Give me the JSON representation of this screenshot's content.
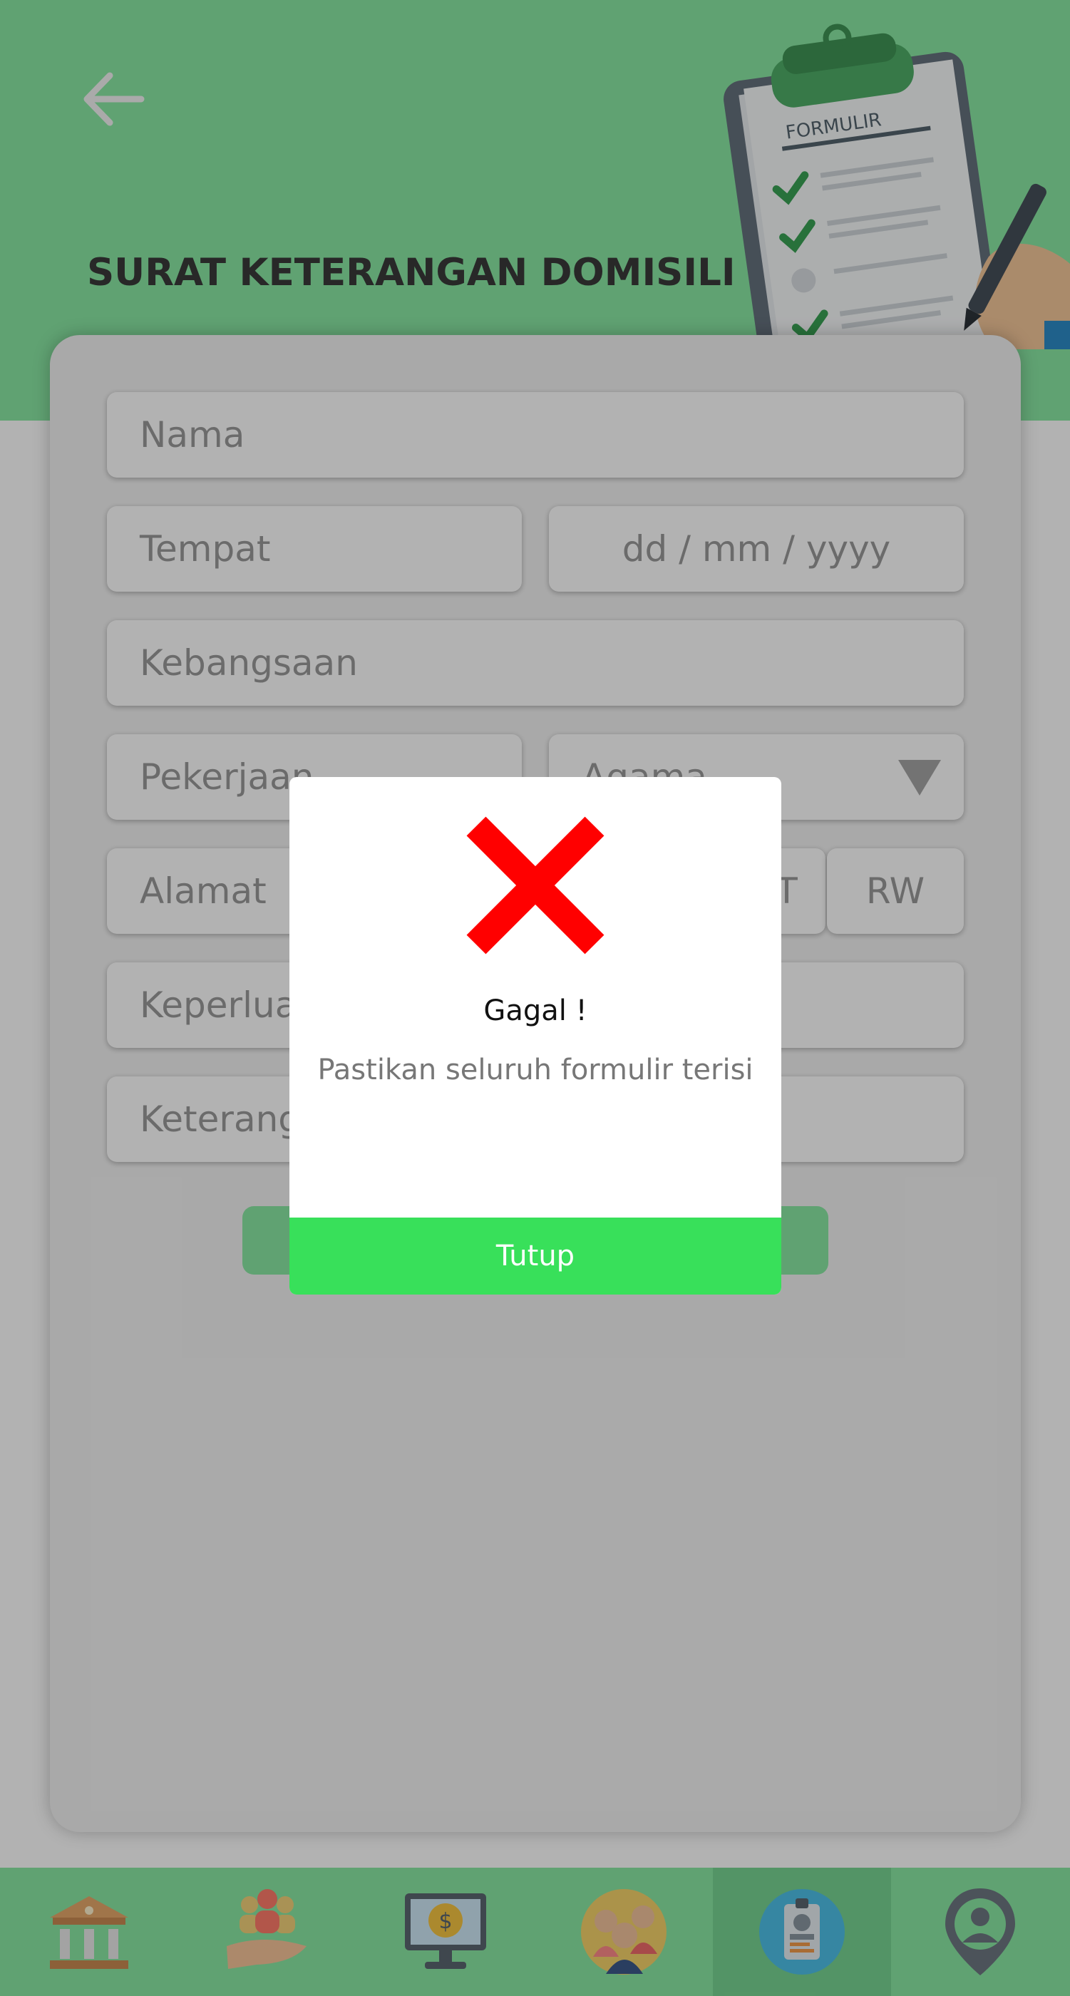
{
  "header": {
    "title": "SURAT KETERANGAN DOMISILI",
    "clipboard_label": "FORMULIR"
  },
  "form": {
    "nama": "Nama",
    "tempat": "Tempat",
    "tanggal": "dd / mm / yyyy",
    "kebangsaan": "Kebangsaan",
    "pekerjaan": "Pekerjaan",
    "agama": "Agama",
    "alamat": "Alamat",
    "rt": "RT",
    "rw": "RW",
    "keperluan": "Keperluan",
    "keterangan": "Keterangan"
  },
  "dialog": {
    "title": "Gagal !",
    "message": "Pastikan seluruh formulir terisi",
    "button": "Tutup"
  },
  "nav": {
    "items": [
      "bank-icon",
      "community-hands-icon",
      "finance-monitor-icon",
      "people-group-icon",
      "id-card-icon",
      "location-person-icon"
    ],
    "active_index": 4
  },
  "colors": {
    "primary": "#8ae8a4",
    "dialog_button": "#38e05a",
    "error": "#ff0000"
  }
}
